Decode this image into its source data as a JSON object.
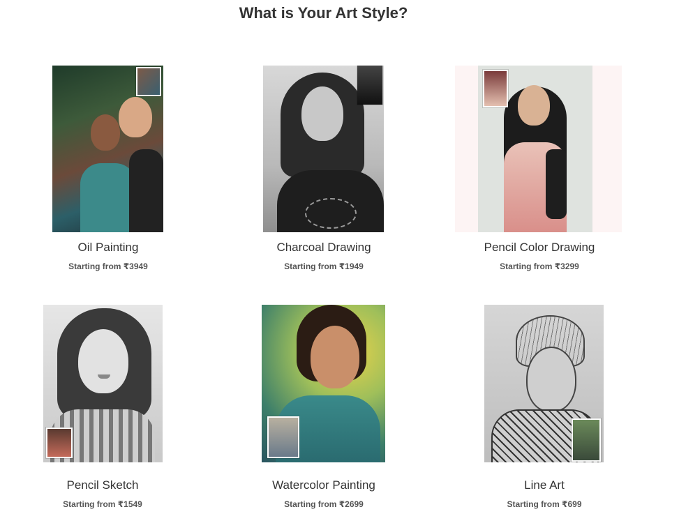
{
  "page": {
    "title": "What is Your Art Style?"
  },
  "styles": [
    {
      "name": "Oil Painting",
      "price": "Starting from ₹3949"
    },
    {
      "name": "Charcoal Drawing",
      "price": "Starting from ₹1949"
    },
    {
      "name": "Pencil Color Drawing",
      "price": "Starting from ₹3299"
    },
    {
      "name": "Pencil Sketch",
      "price": "Starting from ₹1549"
    },
    {
      "name": "Watercolor Painting",
      "price": "Starting from ₹2699"
    },
    {
      "name": "Line Art",
      "price": "Starting from ₹699"
    }
  ]
}
